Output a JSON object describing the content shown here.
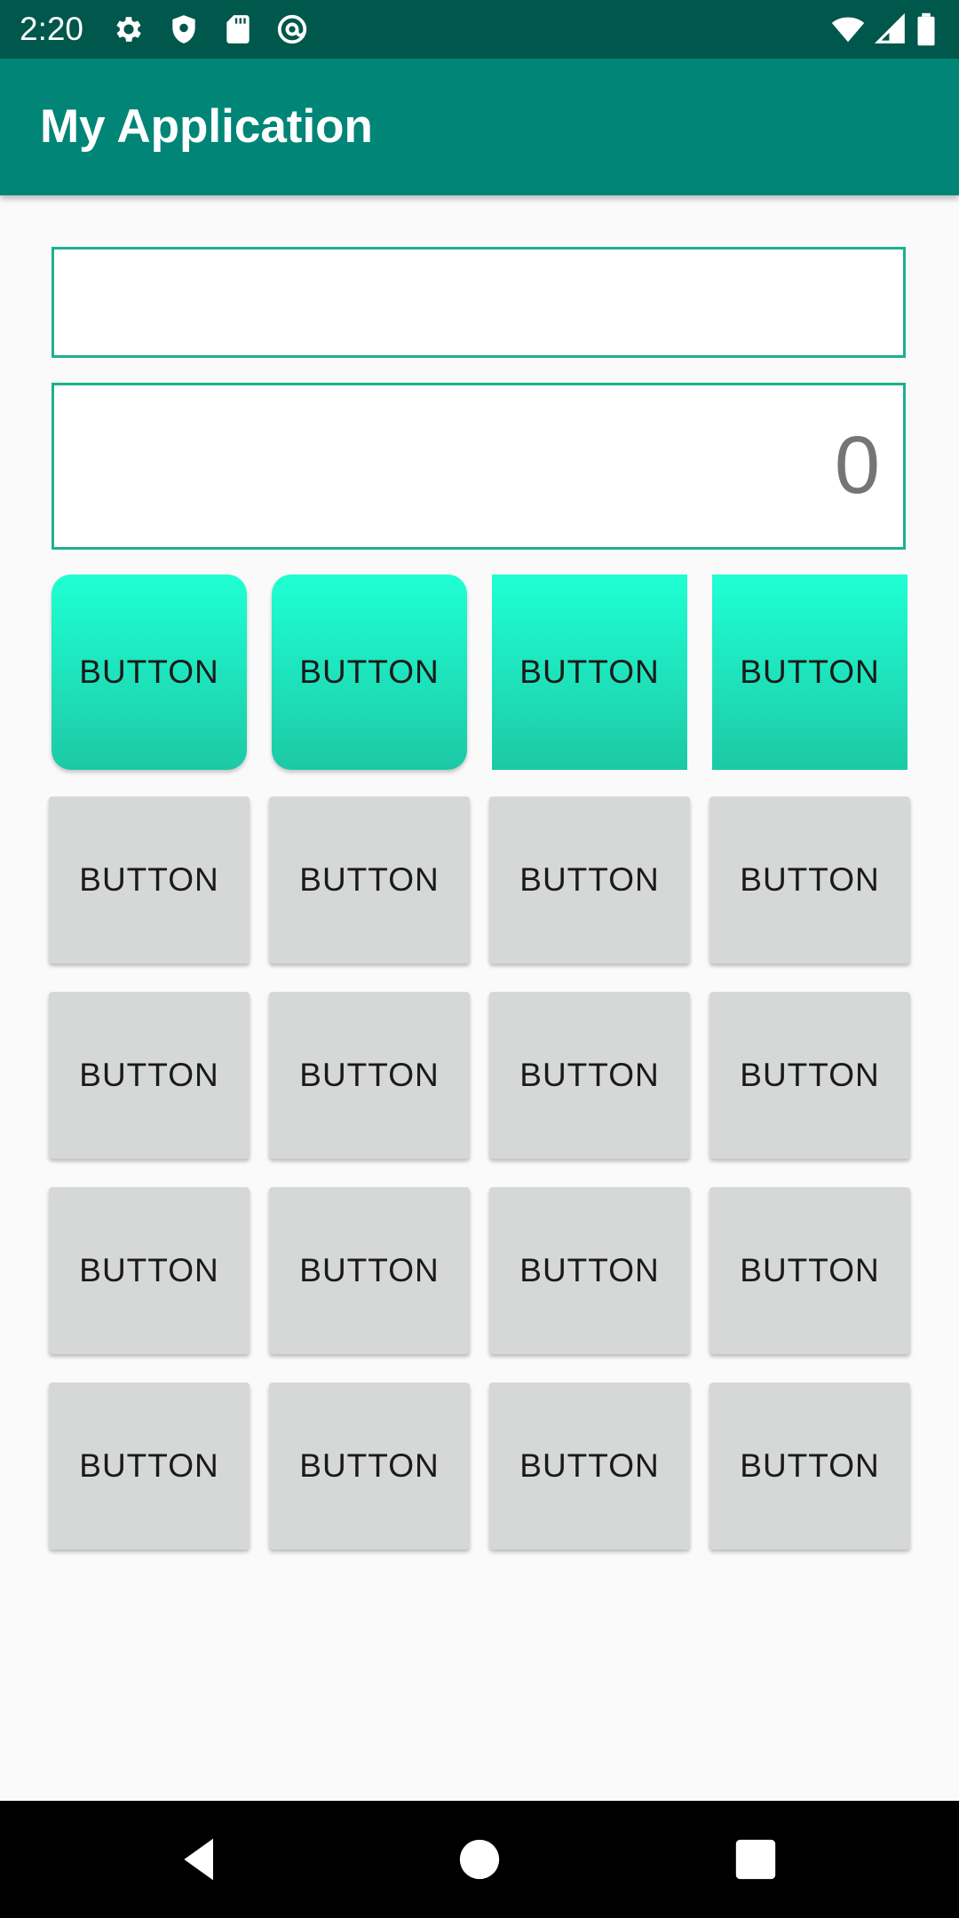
{
  "status_bar": {
    "time": "2:20",
    "icons": [
      "gear-icon",
      "shield-icon",
      "sd-card-icon",
      "at-sign-icon",
      "wifi-icon",
      "signal-icon",
      "battery-icon"
    ]
  },
  "app_bar": {
    "title": "My Application",
    "color": "#008577"
  },
  "expression_field": {
    "value": ""
  },
  "result_field": {
    "value": "0"
  },
  "buttons": {
    "accent_row": [
      "BUTTON",
      "BUTTON",
      "BUTTON",
      "BUTTON"
    ],
    "grid": [
      [
        "BUTTON",
        "BUTTON",
        "BUTTON",
        "BUTTON"
      ],
      [
        "BUTTON",
        "BUTTON",
        "BUTTON",
        "BUTTON"
      ],
      [
        "BUTTON",
        "BUTTON",
        "BUTTON",
        "BUTTON"
      ],
      [
        "BUTTON",
        "BUTTON",
        "BUTTON",
        "BUTTON"
      ]
    ]
  },
  "nav_bar": {
    "icons": [
      "back-icon",
      "home-icon",
      "recents-icon"
    ]
  },
  "colors": {
    "accent_gradient_top": "#1fffd3",
    "accent_gradient_bottom": "#1dc9a6",
    "field_border": "#1db08e",
    "grey_button": "#d6d7d7"
  }
}
